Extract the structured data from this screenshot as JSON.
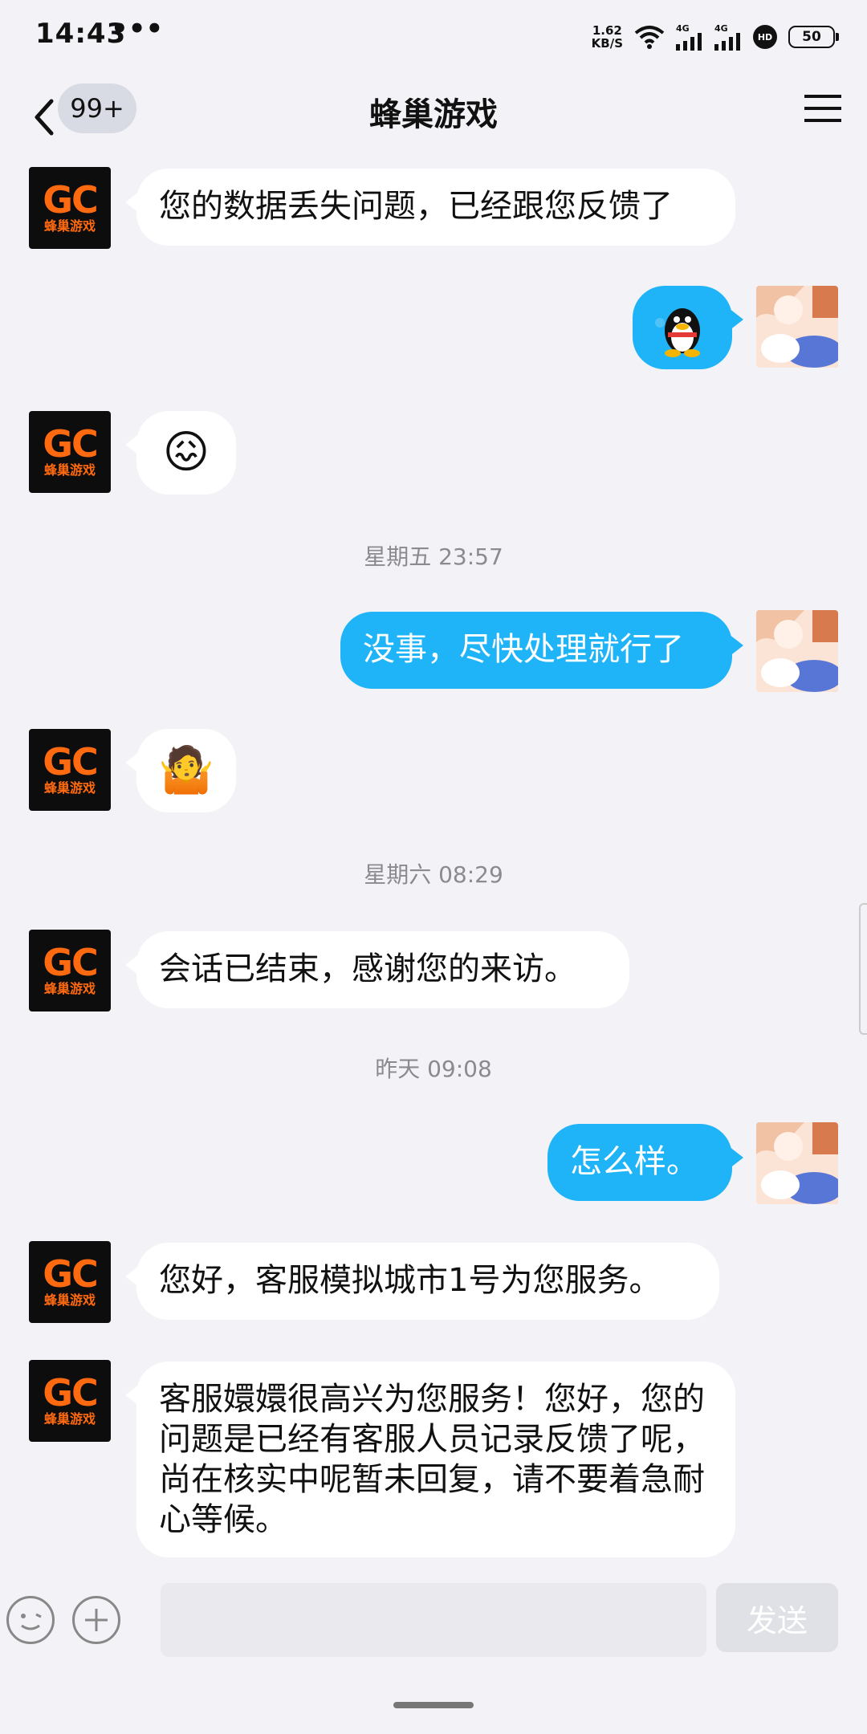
{
  "status_bar": {
    "time": "14:43",
    "more": "•••",
    "net_speed_value": "1.62",
    "net_speed_unit": "KB/S",
    "signal1": "4G",
    "signal2": "4G",
    "hd": "HD",
    "battery": "50"
  },
  "nav": {
    "unread_badge": "99+",
    "title": "蜂巢游戏"
  },
  "avatars": {
    "brand": "GC",
    "brand_sub": "蜂巢游戏"
  },
  "messages": [
    {
      "side": "left",
      "text": "您的数据丢失问题，已经跟您反馈了"
    },
    {
      "side": "right",
      "sticker": "qq-penguin-sticker"
    },
    {
      "side": "left",
      "emoji": "😖"
    },
    {
      "side": "right",
      "text": "没事，尽快处理就行了"
    },
    {
      "side": "left",
      "emoji": "🤷"
    },
    {
      "side": "left",
      "text": "会话已结束，感谢您的来访。"
    },
    {
      "side": "right",
      "text": "怎么样。"
    },
    {
      "side": "left",
      "text": "您好，客服模拟城市1号为您服务。"
    },
    {
      "side": "left",
      "text": "客服嬛嬛很高兴为您服务！您好，您的问题是已经有客服人员记录反馈了呢，尚在核实中呢暂未回复，请不要着急耐心等候。"
    }
  ],
  "timestamps": [
    "星期五 23:57",
    "星期六 08:29",
    "昨天 09:08"
  ],
  "input_bar": {
    "send_label": "发送",
    "input_value": ""
  },
  "colors": {
    "bubble_self": "#1fb4f8",
    "bubble_other": "#ffffff",
    "background": "#f3f3f7",
    "brand_orange": "#ff6a10"
  }
}
